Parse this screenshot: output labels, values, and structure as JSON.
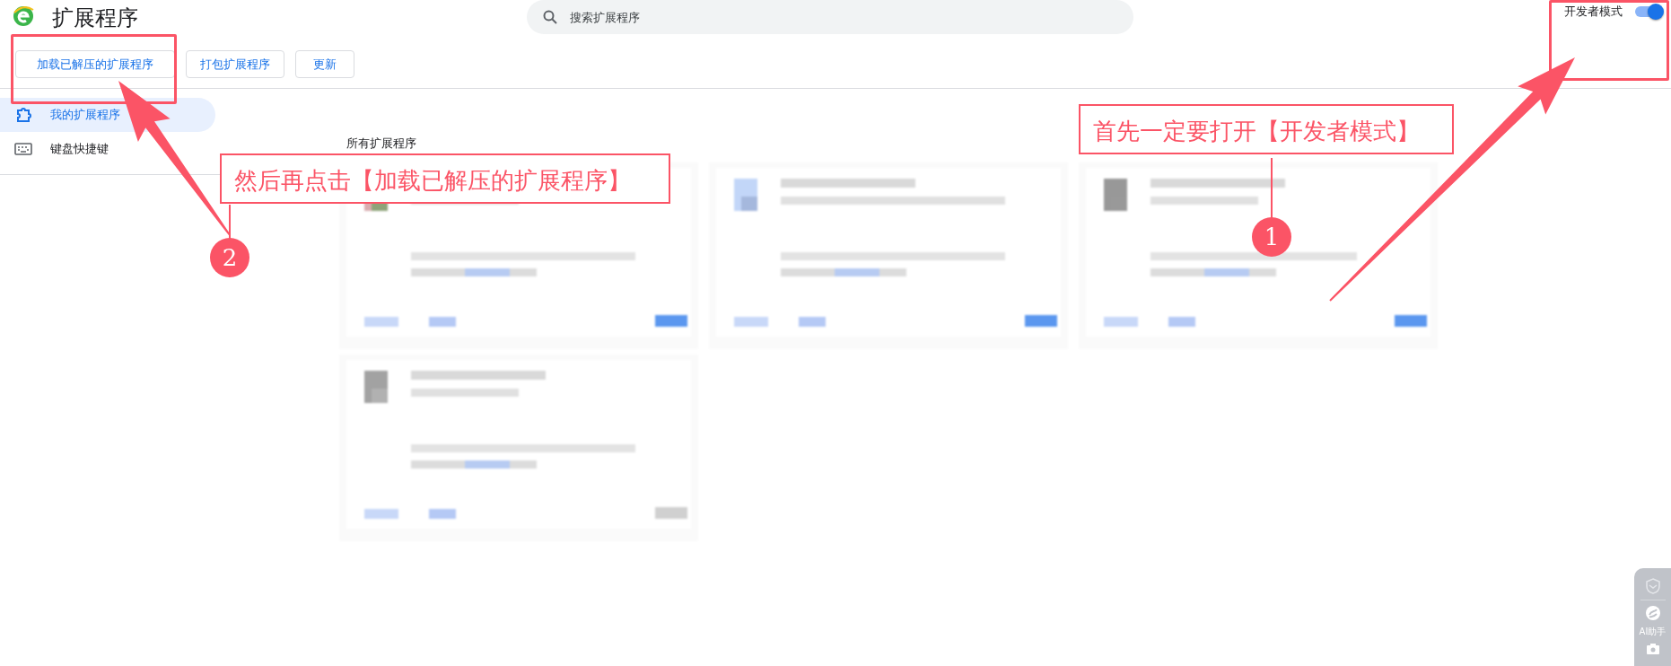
{
  "header": {
    "title": "扩展程序",
    "search": {
      "placeholder": "搜索扩展程序"
    },
    "developer_mode": {
      "label": "开发者模式",
      "on": true
    }
  },
  "toolbar": {
    "buttons": [
      "加载已解压的扩展程序",
      "打包扩展程序",
      "更新"
    ]
  },
  "sidebar": {
    "items": [
      {
        "label": "我的扩展程序",
        "selected": true
      },
      {
        "label": "键盘快捷键",
        "selected": false
      }
    ]
  },
  "section_title": "所有扩展程序",
  "annotations": [
    {
      "number": "1",
      "text": "首先一定要打开【开发者模式】"
    },
    {
      "number": "2",
      "text": "然后再点击【加载已解压的扩展程序】"
    }
  ],
  "side_panel": {
    "label": "AI助手"
  }
}
